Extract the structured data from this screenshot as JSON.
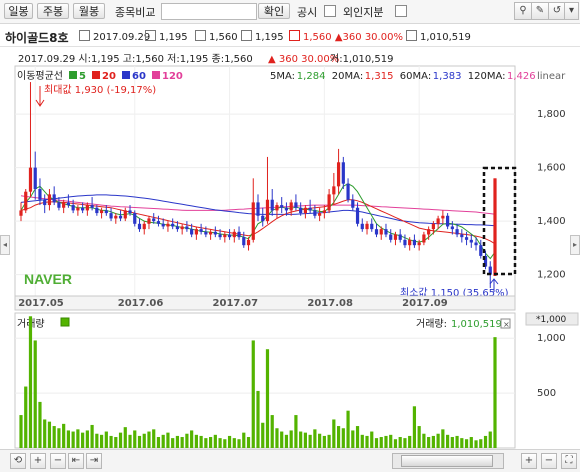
{
  "toolbar": {
    "period_buttons": [
      "일봉",
      "주봉",
      "월봉"
    ],
    "compare_label": "종목비교",
    "compare_value": "",
    "confirm_label": "확인",
    "disclosure_label": "공시",
    "foreign_label": "외인지분"
  },
  "info": {
    "name": "하이골드8호",
    "date": "2017.09.29",
    "open": "1,195",
    "high": "1,560",
    "low": "1,195",
    "close": "1,560",
    "change": "360",
    "change_pct": "30.00%",
    "volume": "1,010,519"
  },
  "price_panel": {
    "header_line": "2017.09.29 시:1,195 고:1,560 저:1,195 종:1,560",
    "change_text": "▲ 360 30.00%",
    "volume_text": "거:1,010,519",
    "ma_title": "이동평균선",
    "ma_items": [
      {
        "label": "5",
        "color": "#2e9d2e"
      },
      {
        "label": "20",
        "color": "#e0221e"
      },
      {
        "label": "60",
        "color": "#2a36c9"
      },
      {
        "label": "120",
        "color": "#e2409a"
      }
    ],
    "ma_values": [
      {
        "label": "5MA:",
        "value": "1,284",
        "color": "#2e9d2e"
      },
      {
        "label": "20MA:",
        "value": "1,315",
        "color": "#e0221e"
      },
      {
        "label": "60MA:",
        "value": "1,383",
        "color": "#2a36c9"
      },
      {
        "label": "120MA:",
        "value": "1,426",
        "color": "#e2409a"
      }
    ],
    "axis_unit": "linear",
    "max_label": "최대값 1,930 (-19,17%)",
    "min_label": "최소값 1,150 (35,65%)",
    "watermark": "NAVER"
  },
  "volume_panel": {
    "title": "거래량",
    "legend_label": "거래량:",
    "legend_value": "1,010,519",
    "unit": "*1,000",
    "color": "#53b300"
  },
  "chart_data": {
    "type": "candlestick",
    "x_labels": [
      "2017.05",
      "2017.06",
      "2017.07",
      "2017.08",
      "2017.09"
    ],
    "y_ticks": [
      1200,
      1400,
      1600,
      1800
    ],
    "y_range": [
      1120,
      1980
    ],
    "volume_ticks": [
      500,
      1000
    ],
    "volume_range": [
      0,
      1230
    ],
    "candles": [
      [
        1420,
        1470,
        1400,
        1440
      ],
      [
        1440,
        1520,
        1430,
        1510
      ],
      [
        1510,
        1920,
        1490,
        1600
      ],
      [
        1600,
        1660,
        1480,
        1520
      ],
      [
        1520,
        1560,
        1460,
        1480
      ],
      [
        1480,
        1500,
        1430,
        1460
      ],
      [
        1460,
        1520,
        1440,
        1500
      ],
      [
        1500,
        1530,
        1460,
        1470
      ],
      [
        1470,
        1490,
        1440,
        1450
      ],
      [
        1450,
        1480,
        1430,
        1470
      ],
      [
        1470,
        1500,
        1450,
        1460
      ],
      [
        1460,
        1480,
        1430,
        1440
      ],
      [
        1440,
        1460,
        1420,
        1450
      ],
      [
        1450,
        1470,
        1430,
        1440
      ],
      [
        1440,
        1470,
        1420,
        1460
      ],
      [
        1460,
        1490,
        1440,
        1450
      ],
      [
        1450,
        1460,
        1420,
        1430
      ],
      [
        1430,
        1450,
        1410,
        1440
      ],
      [
        1440,
        1460,
        1420,
        1430
      ],
      [
        1430,
        1450,
        1400,
        1410
      ],
      [
        1410,
        1430,
        1390,
        1420
      ],
      [
        1420,
        1440,
        1400,
        1410
      ],
      [
        1410,
        1450,
        1400,
        1440
      ],
      [
        1440,
        1460,
        1420,
        1430
      ],
      [
        1430,
        1440,
        1380,
        1390
      ],
      [
        1390,
        1410,
        1360,
        1370
      ],
      [
        1370,
        1400,
        1350,
        1390
      ],
      [
        1390,
        1420,
        1370,
        1410
      ],
      [
        1410,
        1430,
        1390,
        1400
      ],
      [
        1400,
        1420,
        1380,
        1390
      ],
      [
        1390,
        1410,
        1370,
        1380
      ],
      [
        1380,
        1400,
        1360,
        1390
      ],
      [
        1390,
        1410,
        1370,
        1380
      ],
      [
        1380,
        1400,
        1360,
        1370
      ],
      [
        1370,
        1390,
        1350,
        1380
      ],
      [
        1380,
        1400,
        1360,
        1370
      ],
      [
        1370,
        1390,
        1340,
        1350
      ],
      [
        1350,
        1380,
        1330,
        1370
      ],
      [
        1370,
        1390,
        1350,
        1360
      ],
      [
        1360,
        1380,
        1340,
        1350
      ],
      [
        1350,
        1370,
        1330,
        1360
      ],
      [
        1360,
        1380,
        1340,
        1350
      ],
      [
        1350,
        1370,
        1330,
        1340
      ],
      [
        1340,
        1360,
        1320,
        1350
      ],
      [
        1350,
        1370,
        1330,
        1340
      ],
      [
        1340,
        1370,
        1320,
        1360
      ],
      [
        1360,
        1380,
        1330,
        1340
      ],
      [
        1340,
        1360,
        1300,
        1310
      ],
      [
        1310,
        1340,
        1290,
        1330
      ],
      [
        1330,
        1560,
        1320,
        1470
      ],
      [
        1470,
        1500,
        1400,
        1420
      ],
      [
        1420,
        1450,
        1380,
        1400
      ],
      [
        1400,
        1640,
        1390,
        1480
      ],
      [
        1480,
        1520,
        1420,
        1440
      ],
      [
        1440,
        1470,
        1410,
        1460
      ],
      [
        1460,
        1490,
        1430,
        1450
      ],
      [
        1450,
        1470,
        1420,
        1440
      ],
      [
        1440,
        1480,
        1420,
        1470
      ],
      [
        1470,
        1500,
        1440,
        1450
      ],
      [
        1450,
        1470,
        1420,
        1430
      ],
      [
        1430,
        1460,
        1410,
        1450
      ],
      [
        1450,
        1480,
        1430,
        1440
      ],
      [
        1440,
        1460,
        1410,
        1420
      ],
      [
        1420,
        1450,
        1400,
        1430
      ],
      [
        1430,
        1460,
        1410,
        1440
      ],
      [
        1440,
        1520,
        1430,
        1500
      ],
      [
        1500,
        1580,
        1460,
        1530
      ],
      [
        1530,
        1670,
        1500,
        1620
      ],
      [
        1620,
        1640,
        1520,
        1540
      ],
      [
        1540,
        1560,
        1470,
        1480
      ],
      [
        1480,
        1500,
        1440,
        1450
      ],
      [
        1450,
        1470,
        1380,
        1390
      ],
      [
        1390,
        1410,
        1360,
        1370
      ],
      [
        1370,
        1400,
        1350,
        1390
      ],
      [
        1390,
        1410,
        1360,
        1370
      ],
      [
        1370,
        1390,
        1340,
        1350
      ],
      [
        1350,
        1380,
        1330,
        1370
      ],
      [
        1370,
        1390,
        1340,
        1350
      ],
      [
        1350,
        1370,
        1320,
        1330
      ],
      [
        1330,
        1360,
        1310,
        1350
      ],
      [
        1350,
        1370,
        1320,
        1330
      ],
      [
        1330,
        1350,
        1300,
        1310
      ],
      [
        1310,
        1340,
        1290,
        1330
      ],
      [
        1330,
        1350,
        1300,
        1310
      ],
      [
        1310,
        1330,
        1290,
        1320
      ],
      [
        1320,
        1360,
        1310,
        1350
      ],
      [
        1350,
        1380,
        1330,
        1370
      ],
      [
        1370,
        1400,
        1350,
        1390
      ],
      [
        1390,
        1420,
        1370,
        1410
      ],
      [
        1410,
        1440,
        1390,
        1420
      ],
      [
        1420,
        1430,
        1370,
        1380
      ],
      [
        1380,
        1400,
        1350,
        1370
      ],
      [
        1370,
        1390,
        1340,
        1350
      ],
      [
        1350,
        1370,
        1320,
        1340
      ],
      [
        1340,
        1360,
        1310,
        1330
      ],
      [
        1330,
        1350,
        1300,
        1320
      ],
      [
        1320,
        1340,
        1290,
        1310
      ],
      [
        1310,
        1330,
        1260,
        1270
      ],
      [
        1270,
        1290,
        1220,
        1230
      ],
      [
        1230,
        1250,
        1150,
        1200
      ],
      [
        1195,
        1560,
        1195,
        1560
      ]
    ],
    "ma5": [
      1440,
      1470,
      1490,
      1520,
      1530,
      1510,
      1490,
      1480,
      1470,
      1465,
      1460,
      1455,
      1450,
      1450,
      1450,
      1450,
      1445,
      1440,
      1440,
      1435,
      1428,
      1424,
      1425,
      1428,
      1422,
      1410,
      1400,
      1396,
      1394,
      1392,
      1388,
      1385,
      1384,
      1380,
      1376,
      1374,
      1370,
      1366,
      1362,
      1360,
      1358,
      1356,
      1352,
      1350,
      1348,
      1347,
      1346,
      1340,
      1334,
      1360,
      1390,
      1400,
      1420,
      1440,
      1448,
      1452,
      1448,
      1448,
      1452,
      1448,
      1444,
      1442,
      1440,
      1436,
      1436,
      1450,
      1470,
      1500,
      1530,
      1540,
      1530,
      1510,
      1480,
      1450,
      1420,
      1390,
      1375,
      1365,
      1355,
      1350,
      1345,
      1338,
      1330,
      1325,
      1322,
      1326,
      1340,
      1356,
      1372,
      1388,
      1392,
      1390,
      1385,
      1378,
      1365,
      1352,
      1338,
      1310,
      1280,
      1260,
      1284
    ],
    "ma20": [
      1440,
      1445,
      1450,
      1460,
      1466,
      1470,
      1472,
      1472,
      1471,
      1470,
      1468,
      1466,
      1464,
      1462,
      1460,
      1458,
      1456,
      1454,
      1452,
      1450,
      1446,
      1442,
      1438,
      1434,
      1430,
      1426,
      1422,
      1418,
      1414,
      1410,
      1406,
      1402,
      1398,
      1394,
      1390,
      1386,
      1382,
      1378,
      1375,
      1372,
      1369,
      1366,
      1363,
      1360,
      1357,
      1354,
      1351,
      1348,
      1345,
      1350,
      1360,
      1372,
      1385,
      1398,
      1410,
      1420,
      1428,
      1434,
      1438,
      1442,
      1445,
      1448,
      1450,
      1452,
      1454,
      1458,
      1462,
      1468,
      1475,
      1480,
      1480,
      1476,
      1470,
      1462,
      1454,
      1446,
      1438,
      1430,
      1422,
      1414,
      1406,
      1398,
      1390,
      1382,
      1374,
      1370,
      1366,
      1364,
      1362,
      1360,
      1358,
      1356,
      1354,
      1352,
      1350,
      1347,
      1344,
      1340,
      1334,
      1326,
      1315
    ],
    "ma60": [
      1470,
      1472,
      1474,
      1476,
      1478,
      1480,
      1482,
      1484,
      1486,
      1488,
      1490,
      1492,
      1494,
      1495,
      1496,
      1497,
      1498,
      1498,
      1498,
      1497,
      1496,
      1495,
      1494,
      1492,
      1490,
      1488,
      1486,
      1484,
      1481,
      1478,
      1475,
      1472,
      1469,
      1466,
      1463,
      1460,
      1457,
      1454,
      1451,
      1448,
      1445,
      1442,
      1440,
      1438,
      1436,
      1434,
      1432,
      1430,
      1428,
      1427,
      1426,
      1425,
      1425,
      1425,
      1425,
      1425,
      1425,
      1425,
      1426,
      1427,
      1428,
      1429,
      1430,
      1431,
      1432,
      1434,
      1436,
      1438,
      1440,
      1440,
      1439,
      1437,
      1434,
      1430,
      1426,
      1422,
      1418,
      1414,
      1410,
      1406,
      1402,
      1400,
      1398,
      1396,
      1394,
      1393,
      1392,
      1391,
      1390,
      1390,
      1389,
      1389,
      1388,
      1388,
      1387,
      1387,
      1386,
      1386,
      1385,
      1384,
      1383
    ],
    "ma120": [
      1495,
      1492,
      1490,
      1488,
      1486,
      1484,
      1482,
      1480,
      1478,
      1476,
      1474,
      1472,
      1470,
      1468,
      1466,
      1464,
      1462,
      1460,
      1458,
      1456,
      1455,
      1454,
      1453,
      1452,
      1451,
      1450,
      1449,
      1448,
      1447,
      1446,
      1445,
      1444,
      1443,
      1442,
      1441,
      1440,
      1440,
      1440,
      1440,
      1440,
      1440,
      1440,
      1440,
      1441,
      1442,
      1443,
      1444,
      1445,
      1446,
      1447,
      1448,
      1449,
      1450,
      1451,
      1452,
      1453,
      1454,
      1455,
      1456,
      1457,
      1458,
      1459,
      1460,
      1460,
      1460,
      1460,
      1460,
      1460,
      1460,
      1460,
      1460,
      1459,
      1458,
      1457,
      1456,
      1455,
      1454,
      1453,
      1452,
      1451,
      1450,
      1449,
      1448,
      1447,
      1446,
      1445,
      1444,
      1443,
      1442,
      1441,
      1440,
      1439,
      1438,
      1437,
      1436,
      1435,
      1434,
      1432,
      1430,
      1428,
      1426
    ],
    "volume": [
      300,
      560,
      1200,
      980,
      420,
      260,
      240,
      200,
      180,
      220,
      160,
      150,
      170,
      140,
      160,
      210,
      130,
      120,
      150,
      110,
      100,
      140,
      190,
      120,
      160,
      110,
      130,
      150,
      170,
      100,
      120,
      140,
      90,
      110,
      100,
      130,
      160,
      120,
      110,
      90,
      100,
      120,
      90,
      80,
      110,
      90,
      80,
      140,
      100,
      980,
      520,
      230,
      900,
      300,
      180,
      150,
      120,
      160,
      300,
      150,
      140,
      120,
      170,
      130,
      110,
      120,
      260,
      200,
      180,
      340,
      160,
      200,
      120,
      110,
      150,
      90,
      100,
      110,
      120,
      80,
      100,
      90,
      110,
      380,
      200,
      130,
      100,
      110,
      130,
      170,
      120,
      100,
      110,
      90,
      80,
      100,
      70,
      80,
      110,
      150,
      1010
    ]
  }
}
